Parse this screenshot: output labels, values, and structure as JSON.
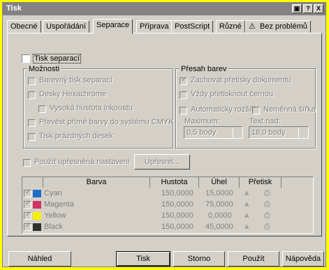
{
  "window": {
    "title": "Tisk",
    "help_btn": "?",
    "close_btn": "X"
  },
  "tabs": [
    {
      "label": "Obecné"
    },
    {
      "label": "Uspořádání"
    },
    {
      "label": "Separace"
    },
    {
      "label": "Příprava"
    },
    {
      "label": "PostScript"
    },
    {
      "label": "Různé"
    },
    {
      "label": "Bez problémů",
      "icon": "warning-icon"
    }
  ],
  "print_separations": {
    "label": "Tisk separací",
    "checked": false
  },
  "options": {
    "title": "Možnosti",
    "items": [
      {
        "label": "Barevný tisk separací",
        "checked": false
      },
      {
        "label": "Desky Hexachrome",
        "checked": false
      },
      {
        "label": "Vysoká hustota inkoustu",
        "checked": false
      },
      {
        "label": "Převést přímé barvy do systému CMYK",
        "checked": false
      },
      {
        "label": "Tisk prázdných desek",
        "checked": false
      }
    ]
  },
  "trapping": {
    "title": "Přesah barev",
    "preserve": {
      "label": "Zachovat přetisky dokumentu",
      "checked": true
    },
    "always_black": {
      "label": "Vždy přetisknout černou",
      "checked": false
    },
    "auto_spread": {
      "label": "Automaticky rozšířit",
      "checked": false
    },
    "fixed_width": {
      "label": "Neměnná šířka",
      "checked": false
    },
    "maximum": {
      "label": "Maximum:",
      "value": "0,5 body"
    },
    "text_over": {
      "label": "Text nad:",
      "value": "18,0 body"
    }
  },
  "advanced": {
    "label": "Použít upřesněná nastavení",
    "checked": false,
    "button": "Upřesnit..."
  },
  "table": {
    "headers": {
      "color": "Barva",
      "density": "Hustota",
      "angle": "Úhel",
      "overprint": "Přetisk"
    },
    "rows": [
      {
        "checked": true,
        "color": "#1e6ec8",
        "name": "Cyan",
        "density": "150,0000",
        "angle": "15,0000"
      },
      {
        "checked": true,
        "color": "#d23264",
        "name": "Magenta",
        "density": "150,0000",
        "angle": "75,0000"
      },
      {
        "checked": true,
        "color": "#f5f000",
        "name": "Yellow",
        "density": "150,0000",
        "angle": "0,0000"
      },
      {
        "checked": true,
        "color": "#303030",
        "name": "Black",
        "density": "150,0000",
        "angle": "45,0000"
      }
    ]
  },
  "buttons": {
    "preview": "Náhled",
    "print": "Tisk",
    "cancel": "Storno",
    "apply": "Použít",
    "help": "Nápověda"
  }
}
